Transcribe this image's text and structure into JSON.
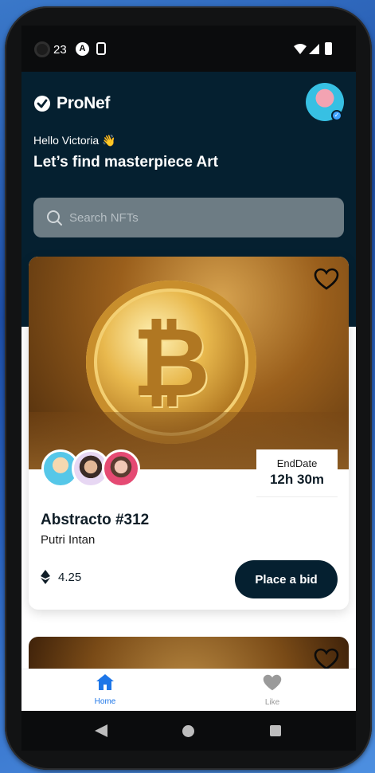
{
  "status_bar": {
    "time": "23",
    "icon_a": "A",
    "icons": [
      "camera-icon",
      "accessibility-icon",
      "clipboard-icon",
      "wifi-icon",
      "signal-icon",
      "battery-icon"
    ]
  },
  "app": {
    "brand": "ProNef",
    "greeting": "Hello Victoria 👋",
    "headline": "Let’s find masterpiece Art",
    "search": {
      "placeholder": "Search NFTs"
    }
  },
  "featured": {
    "title": "Abstracto #312",
    "creator": "Putri Intan",
    "end_date_label": "EndDate",
    "end_date_value": "12h 30m",
    "price": "4.25",
    "bid_label": "Place a bid",
    "owners_count": 3,
    "image_symbol": "₿"
  },
  "bottom_nav": {
    "items": [
      {
        "label": "Home",
        "icon": "home-icon",
        "active": true
      },
      {
        "label": "Like",
        "icon": "heart-icon",
        "active": false
      }
    ]
  },
  "colors": {
    "primary_dark": "#052030",
    "accent_blue": "#1d76e8",
    "search_bg": "#6d7c84"
  }
}
